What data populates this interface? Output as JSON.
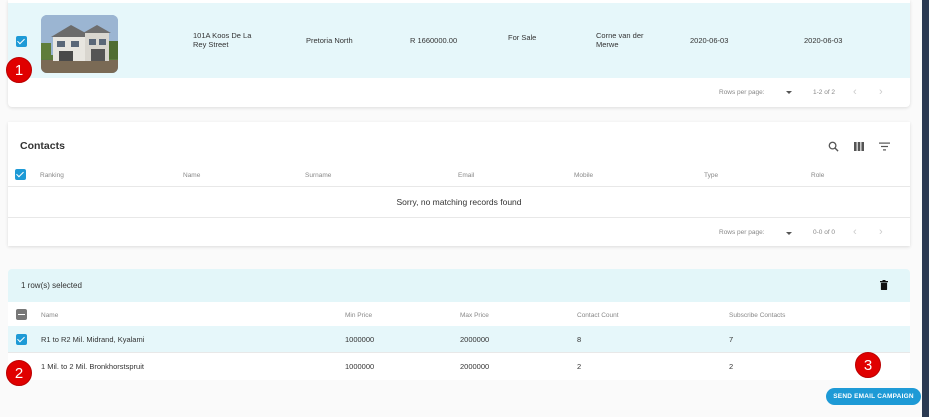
{
  "property_table": {
    "row": {
      "address": "101A Koos De La Rey Street",
      "area": "Pretoria North",
      "price": "R 1660000.00",
      "status": "For Sale",
      "agent": "Corne van der Merwe",
      "date1": "2020-06-03",
      "date2": "2020-06-03"
    },
    "footer": {
      "rows_per_page_label": "Rows per page:",
      "range": "1-2 of 2"
    }
  },
  "contacts": {
    "title": "Contacts",
    "columns": [
      "Ranking",
      "Name",
      "Surname",
      "Email",
      "Mobile",
      "Type",
      "Role"
    ],
    "empty_message": "Sorry, no matching records found",
    "footer": {
      "rows_per_page_label": "Rows per page:",
      "range": "0-0 of 0"
    },
    "icons": [
      "search-icon",
      "view-columns-icon",
      "filter-icon"
    ]
  },
  "selection": {
    "banner_text": "1 row(s) selected",
    "columns": [
      "Name",
      "Min Price",
      "Max Price",
      "Contact Count",
      "Subscribe Contacts"
    ],
    "rows": [
      {
        "name": "R1 to R2 Mil. Midrand, Kyalami",
        "min": "1000000",
        "max": "2000000",
        "count": "8",
        "subscribe": "7",
        "selected": true
      },
      {
        "name": "1 Mil. to 2 Mil. Bronkhorstspruit",
        "min": "1000000",
        "max": "2000000",
        "count": "2",
        "subscribe": "2",
        "selected": false
      }
    ]
  },
  "badges": [
    "1",
    "2",
    "3"
  ],
  "send_button": "SEND EMAIL CAMPAIGN",
  "colors": {
    "accent": "#1e9ad6",
    "row_highlight": "#e6f7fa",
    "badge": "#e00000"
  }
}
